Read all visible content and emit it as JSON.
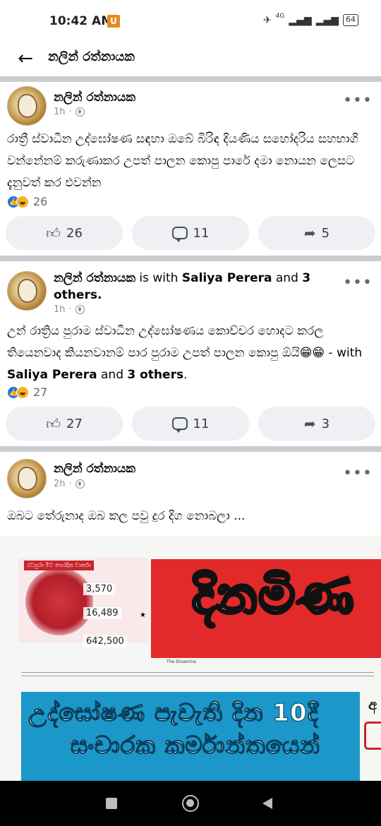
{
  "status_bar": {
    "time": "10:42 AM",
    "carrier_badge": "U",
    "network": "4G",
    "battery": "64"
  },
  "app_bar": {
    "title": "නලින් රත්නායක"
  },
  "posts": [
    {
      "author": "නලින් රත්නායක",
      "with_text": "",
      "time": "1h",
      "text": "රාත්‍රී ස්වාධීන උද්ඝෝෂණ සඳහා ඔබේ බිරිඳ දියණිය සහෝදරිය සහභාගි වන්නේනම් කරුණාකර උපත් පාලන කොපු පාරේ දමා නොයන ලෙසට දැනුවත් කර එවන්න",
      "reactions_count": "26",
      "likes": "26",
      "comments": "11",
      "shares": "5"
    },
    {
      "author": "නලින් රත්නායක",
      "with_prefix": "is with",
      "with_name": "Saliya Perera",
      "with_and": "and",
      "with_others": "3 others",
      "time": "1h",
      "text": "උන් රාත්‍රිය පුරාම ස්වාධීන උද්ඝෝෂණය කොච්චර හොදට කරල තියෙනවාද කියනවානම් පාර පුරාම උපත් පාලන කොපු ඕයි😁😁",
      "text_suffix": " - with ",
      "text_with_name": "Saliya Perera",
      "text_and": " and ",
      "text_others": "3 others",
      "text_end": ".",
      "reactions_count": "27",
      "likes": "27",
      "comments": "11",
      "shares": "3"
    },
    {
      "author": "නලින් රත්නායක",
      "time": "2h",
      "text": "ඔබට තේරුනාද ඔබ කල පවු දුර දිග නොබලා ...",
      "image": {
        "left_header": "රටපුරා මීට පෙරදින වාර්තා",
        "stat_1": "3,570",
        "stat_2": "16,489",
        "stat_3": "642,500",
        "masthead": "දිනමිණ",
        "masthead_small": "The Dinamina",
        "banner_line_1": "උද්ඝෝෂණ පැවැති දින 10දී",
        "banner_line_2": "සංචාරක කර්මාන්තයෙන්",
        "right_edge_char": "අ"
      }
    }
  ]
}
